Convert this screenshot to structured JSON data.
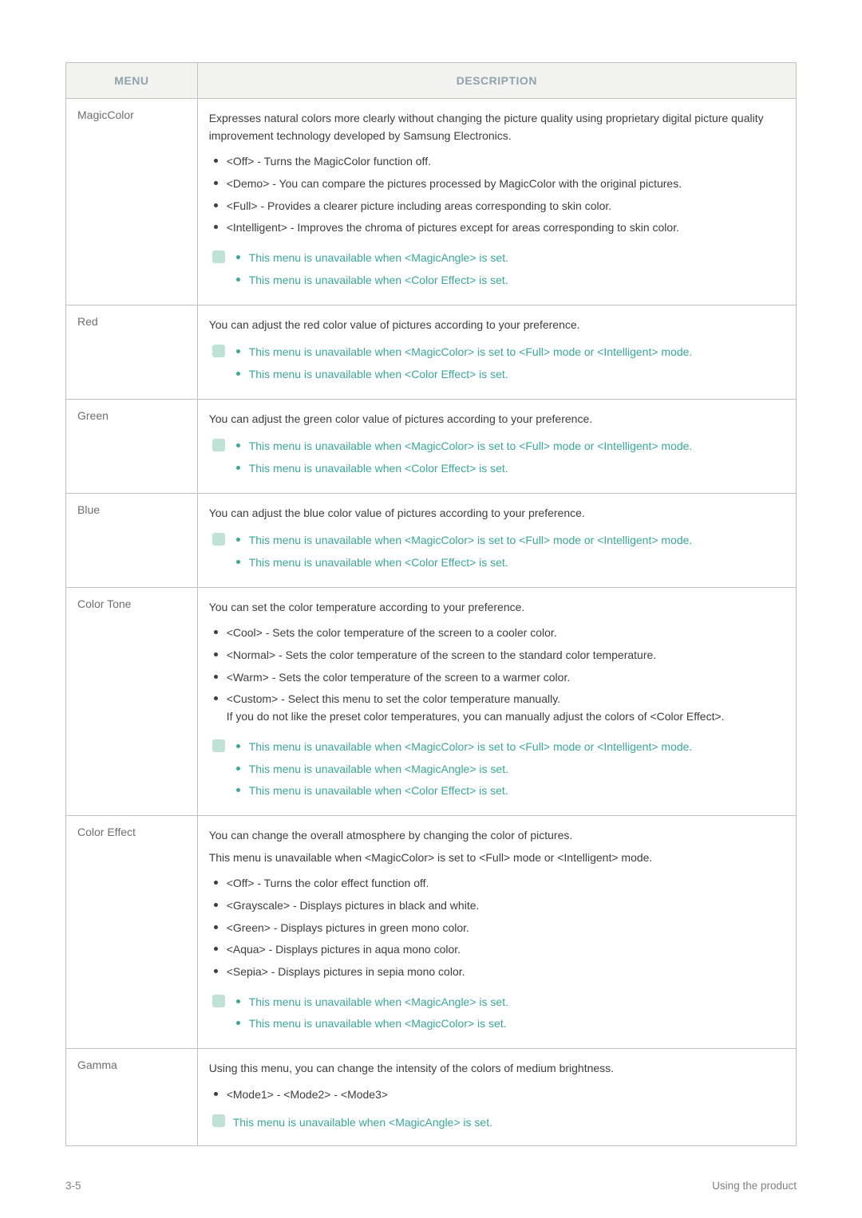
{
  "header": {
    "menu": "MENU",
    "description": "DESCRIPTION"
  },
  "rows": {
    "magiccolor": {
      "menu": "MagicColor",
      "intro": "Expresses natural colors more clearly without changing the picture quality using proprietary digital picture quality improvement technology developed by Samsung Electronics.",
      "bullets": [
        "<Off> - Turns the MagicColor function off.",
        "<Demo> - You can compare the pictures processed by MagicColor with the original pictures.",
        "<Full> - Provides a clearer picture including areas corresponding to skin color.",
        "<Intelligent> - Improves the chroma of pictures except for areas corresponding to skin color."
      ],
      "notes": [
        "This menu is unavailable when <MagicAngle> is set.",
        "This menu is unavailable when <Color Effect> is set."
      ]
    },
    "red": {
      "menu": "Red",
      "intro": "You can adjust the red color value of pictures according to your preference.",
      "notes": [
        "This menu is unavailable when <MagicColor> is set to <Full> mode or <Intelligent> mode.",
        "This menu is unavailable when <Color Effect> is set."
      ]
    },
    "green": {
      "menu": "Green",
      "intro": "You can adjust the green color value of pictures according to your preference.",
      "notes": [
        "This menu is unavailable when <MagicColor> is set to <Full> mode or <Intelligent> mode.",
        "This menu is unavailable when <Color Effect> is set."
      ]
    },
    "blue": {
      "menu": "Blue",
      "intro": "You can adjust the blue color value of pictures according to your preference.",
      "notes": [
        "This menu is unavailable when <MagicColor> is set to <Full> mode or <Intelligent> mode.",
        "This menu is unavailable when <Color Effect> is set."
      ]
    },
    "colortone": {
      "menu": "Color Tone",
      "intro": "You can set the color temperature according to your preference.",
      "bullets": [
        "<Cool> - Sets the color temperature of the screen to a cooler color.",
        "<Normal> - Sets the color temperature of the screen to the standard color temperature.",
        "<Warm> - Sets the color temperature of the screen to a warmer color.",
        "<Custom> - Select this menu to set the color temperature manually.\nIf you do not like the preset color temperatures, you can manually adjust the colors of <Color Effect>."
      ],
      "notes": [
        "This menu is unavailable when <MagicColor> is set to <Full> mode or <Intelligent> mode.",
        "This menu is unavailable when <MagicAngle> is set.",
        "This menu is unavailable when <Color Effect> is set."
      ]
    },
    "coloreffect": {
      "menu": "Color Effect",
      "intro1": "You can change the overall atmosphere by changing the color of pictures.",
      "intro2": "This menu is unavailable when <MagicColor> is set to <Full> mode or <Intelligent> mode.",
      "bullets": [
        "<Off> - Turns the color effect function off.",
        "<Grayscale> - Displays pictures in black and white.",
        "<Green> - Displays pictures in green mono color.",
        "<Aqua> - Displays pictures in aqua mono color.",
        "<Sepia> - Displays pictures in sepia mono color."
      ],
      "notes": [
        "This menu is unavailable when <MagicAngle> is set.",
        "This menu is unavailable when <MagicColor> is set."
      ]
    },
    "gamma": {
      "menu": "Gamma",
      "intro": "Using this menu, you can change the intensity of the colors of medium brightness.",
      "bullets": [
        "<Mode1> - <Mode2> - <Mode3>"
      ],
      "note_single": "This menu is unavailable when <MagicAngle> is set."
    }
  },
  "footer": {
    "left": "3-5",
    "right": "Using the product"
  }
}
